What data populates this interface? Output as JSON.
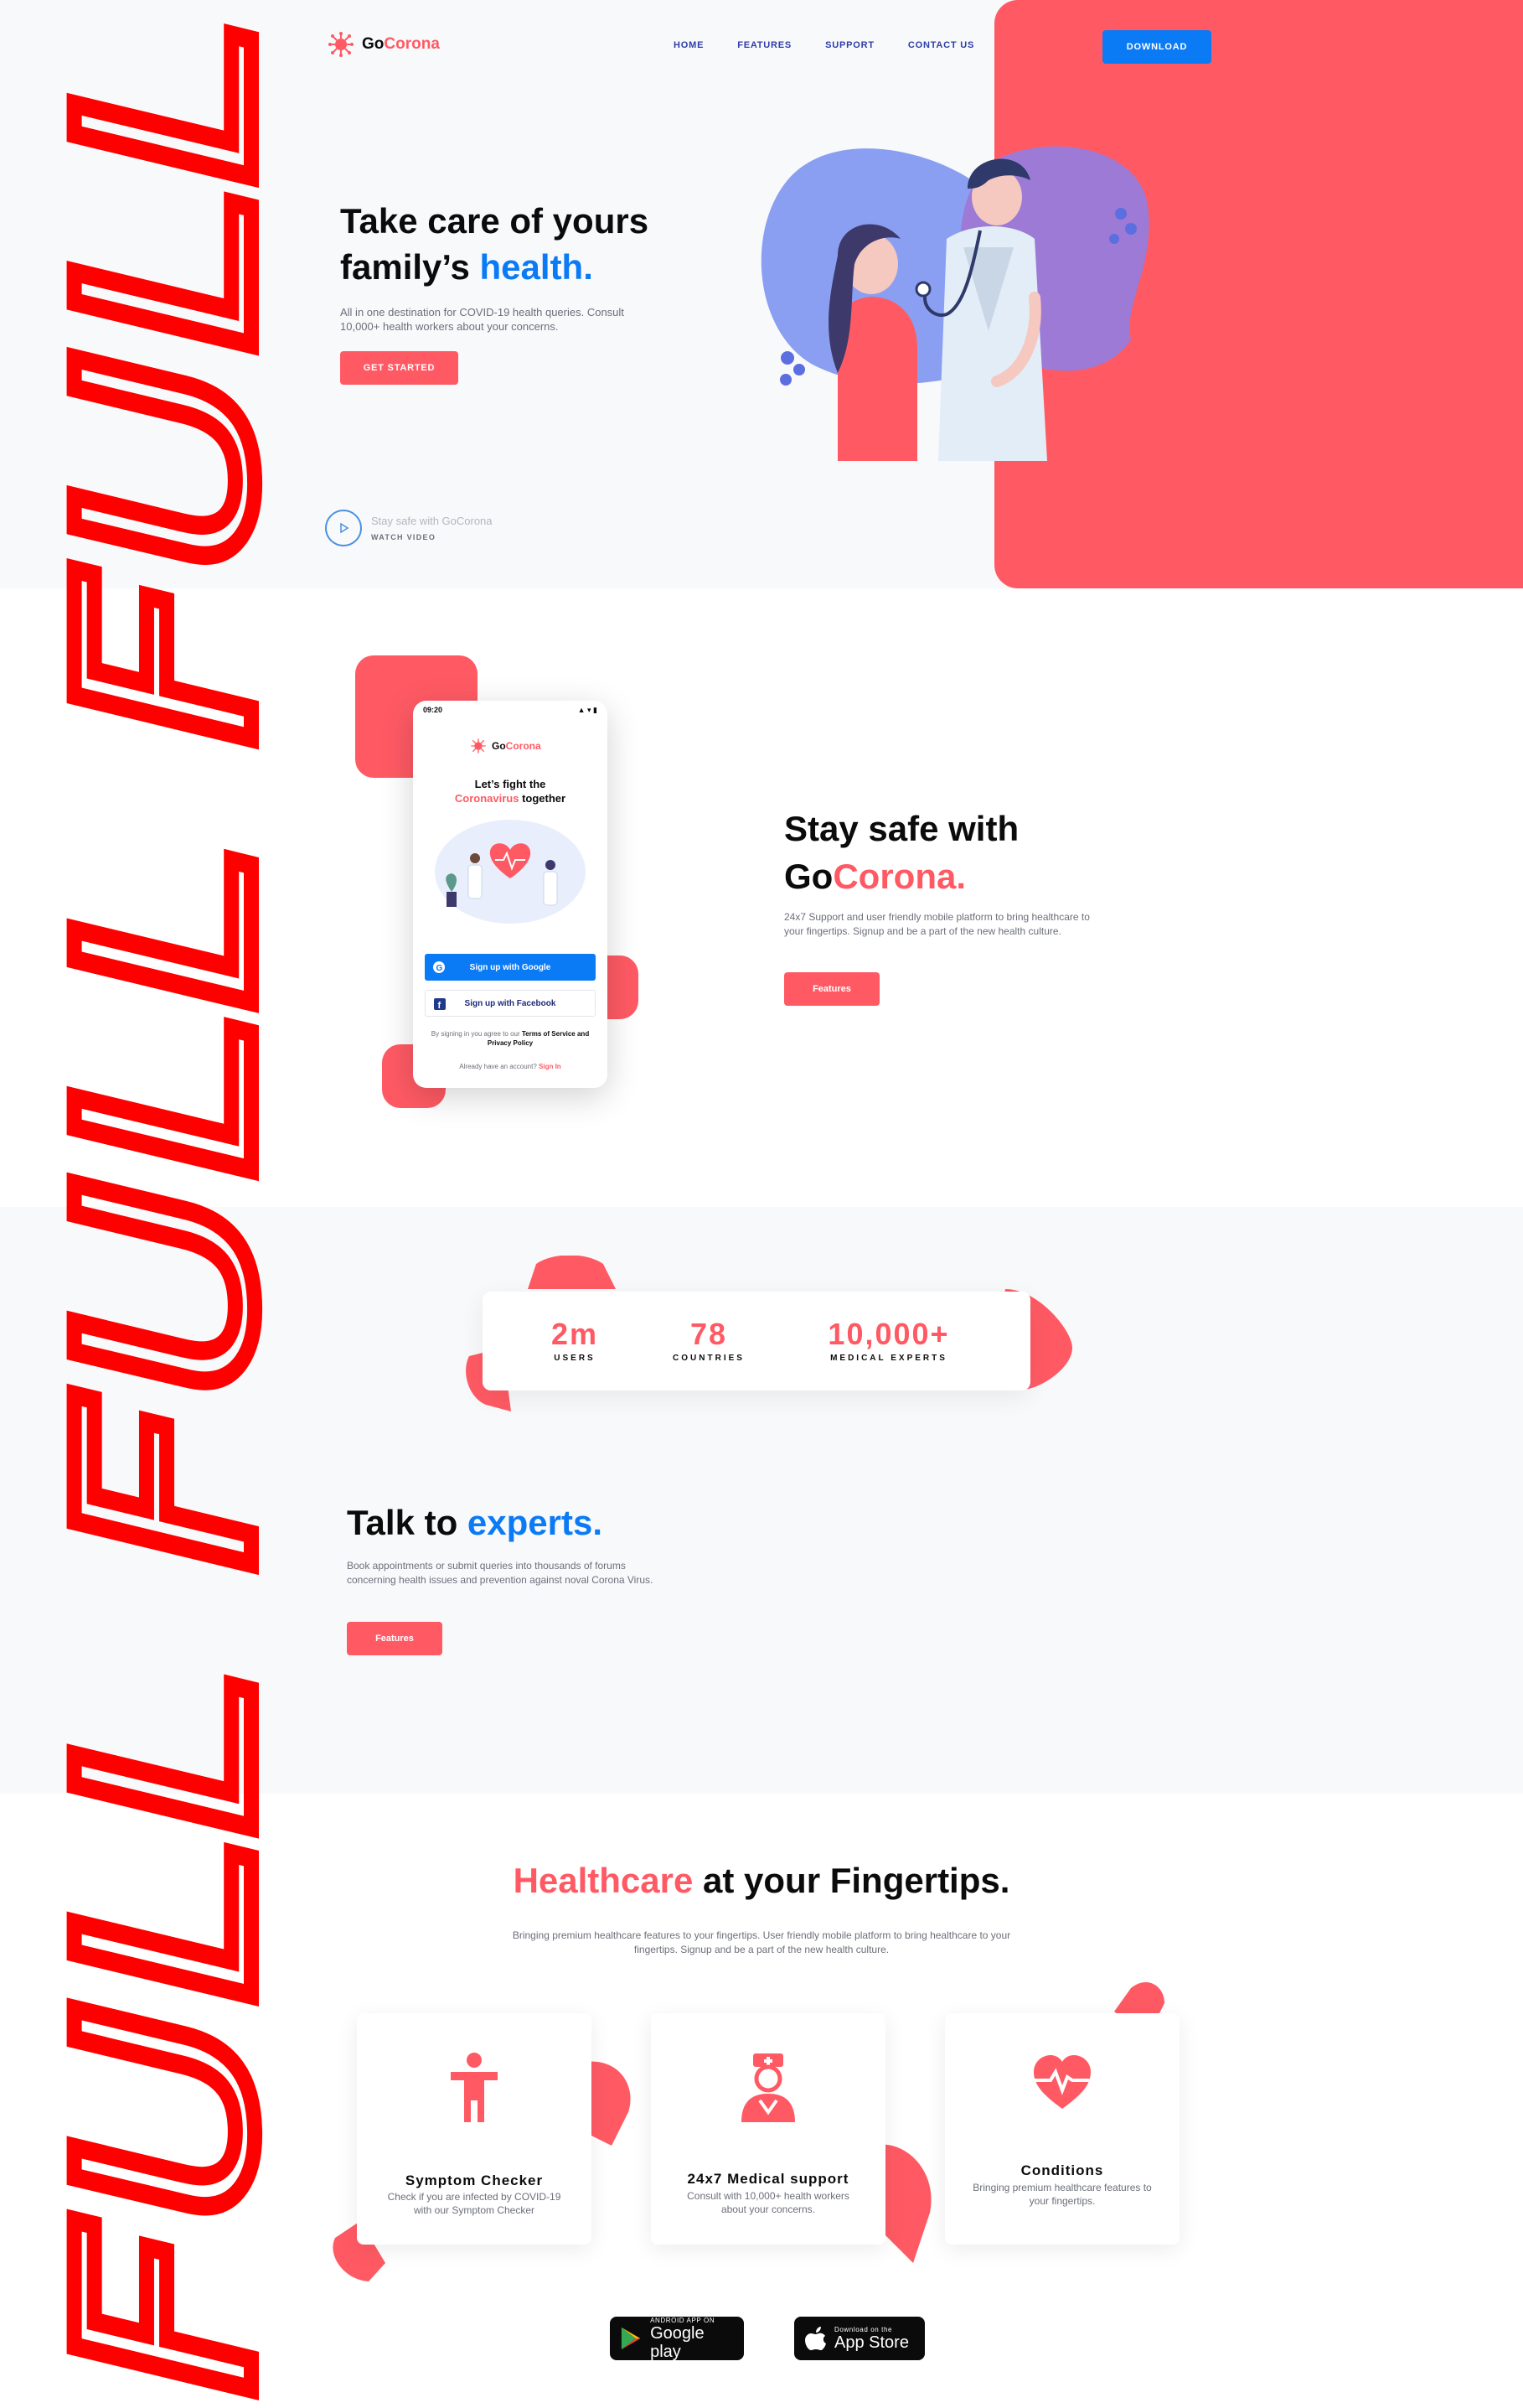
{
  "brand": {
    "go": "Go",
    "corona": "Corona"
  },
  "nav": {
    "items": [
      "HOME",
      "FEATURES",
      "SUPPORT",
      "CONTACT US"
    ],
    "download": "DOWNLOAD"
  },
  "hero": {
    "title_line1": "Take care of yours",
    "title_line2_pre": "family’s ",
    "title_line2_hl": "health.",
    "subtitle": "All in one destination for COVID-19 health queries. Consult 10,000+ health workers about your concerns.",
    "cta": "GET STARTED",
    "watch_title": "Stay safe with GoCorona",
    "watch_label": "WATCH VIDEO"
  },
  "phone": {
    "time": "09:20",
    "title_line1": "Let’s fight the",
    "title_hl": "Coronavirus",
    "title_rest": " together",
    "google_btn": "Sign up with Google",
    "facebook_btn": "Sign up with Facebook",
    "terms_pre": "By signing in you agree to our ",
    "terms_bold": "Terms of Service and Privacy Policy",
    "signin_pre": "Already have an account? ",
    "signin_link": "Sign In"
  },
  "section2": {
    "title_line1": "Stay safe with",
    "title_go": "Go",
    "title_corona": "Corona.",
    "subtitle": "24x7 Support and user friendly mobile platform to bring healthcare to your fingertips. Signup and be a part of the new health culture.",
    "cta": "Features"
  },
  "stats": [
    {
      "value": "2m",
      "label": "USERS"
    },
    {
      "value": "78",
      "label": "COUNTRIES"
    },
    {
      "value": "10,000+",
      "label": "MEDICAL EXPERTS"
    }
  ],
  "section3": {
    "title_pre": "Talk to ",
    "title_hl": "experts.",
    "subtitle": "Book appointments or submit queries into thousands of forums concerning health issues and prevention against noval Corona Virus.",
    "cta": "Features"
  },
  "section4": {
    "title_hl": "Healthcare",
    "title_rest": " at your Fingertips.",
    "subtitle": "Bringing premium healthcare features to your fingertips. User friendly mobile platform to bring healthcare to your fingertips. Signup and be a part of the new health culture.",
    "cards": [
      {
        "icon": "person-icon",
        "title": "Symptom Checker",
        "desc": "Check if you are infected by COVID-19 with our Symptom Checker"
      },
      {
        "icon": "nurse-icon",
        "title": "24x7 Medical support",
        "desc": "Consult with 10,000+ health workers about your concerns."
      },
      {
        "icon": "heartbeat-icon",
        "title": "Conditions",
        "desc": "Bringing premium healthcare features to your fingertips."
      }
    ]
  },
  "stores": {
    "google_small": "ANDROID APP ON",
    "google_big": "Google play",
    "apple_small": "Download on the",
    "apple_big": "App Store"
  },
  "overlay_text": "FULL FULL FULL",
  "colors": {
    "accent_red": "#ff5a64",
    "accent_blue": "#0b7bf5",
    "nav_blue": "#2d3da8",
    "overlay_red": "#ff0000"
  }
}
